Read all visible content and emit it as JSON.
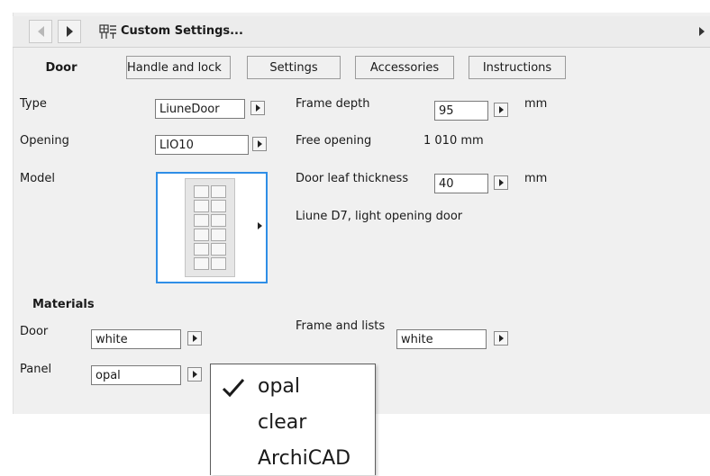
{
  "titlebar": {
    "title": "Custom Settings...",
    "icon": "settings-grid-icon"
  },
  "tabs": [
    {
      "label": "Door",
      "active": true
    },
    {
      "label": "Handle and lock",
      "active": false
    },
    {
      "label": "Settings",
      "active": false
    },
    {
      "label": "Accessories",
      "active": false
    },
    {
      "label": "Instructions",
      "active": false
    }
  ],
  "fields": {
    "type": {
      "label": "Type",
      "value": "LiuneDoor"
    },
    "opening": {
      "label": "Opening",
      "value": "LIO10"
    },
    "model": {
      "label": "Model"
    },
    "frame_depth": {
      "label": "Frame depth",
      "value": "95",
      "unit": "mm"
    },
    "free_opening": {
      "label": "Free opening",
      "value": "1 010 mm"
    },
    "door_leaf_thickness": {
      "label": "Door leaf thickness",
      "value": "40",
      "unit": "mm"
    },
    "description": "Liune D7, light opening door"
  },
  "materials": {
    "heading": "Materials",
    "door": {
      "label": "Door",
      "value": "white"
    },
    "panel": {
      "label": "Panel",
      "value": "opal"
    },
    "frame_and_lists": {
      "label": "Frame and lists",
      "value": "white"
    }
  },
  "dropdown": {
    "items": [
      {
        "label": "opal",
        "checked": true
      },
      {
        "label": "clear",
        "checked": false
      },
      {
        "label": "ArchiCAD",
        "checked": false
      }
    ]
  },
  "colors": {
    "accent": "#2f8ee6",
    "panel_bg": "#f0f0f0"
  }
}
